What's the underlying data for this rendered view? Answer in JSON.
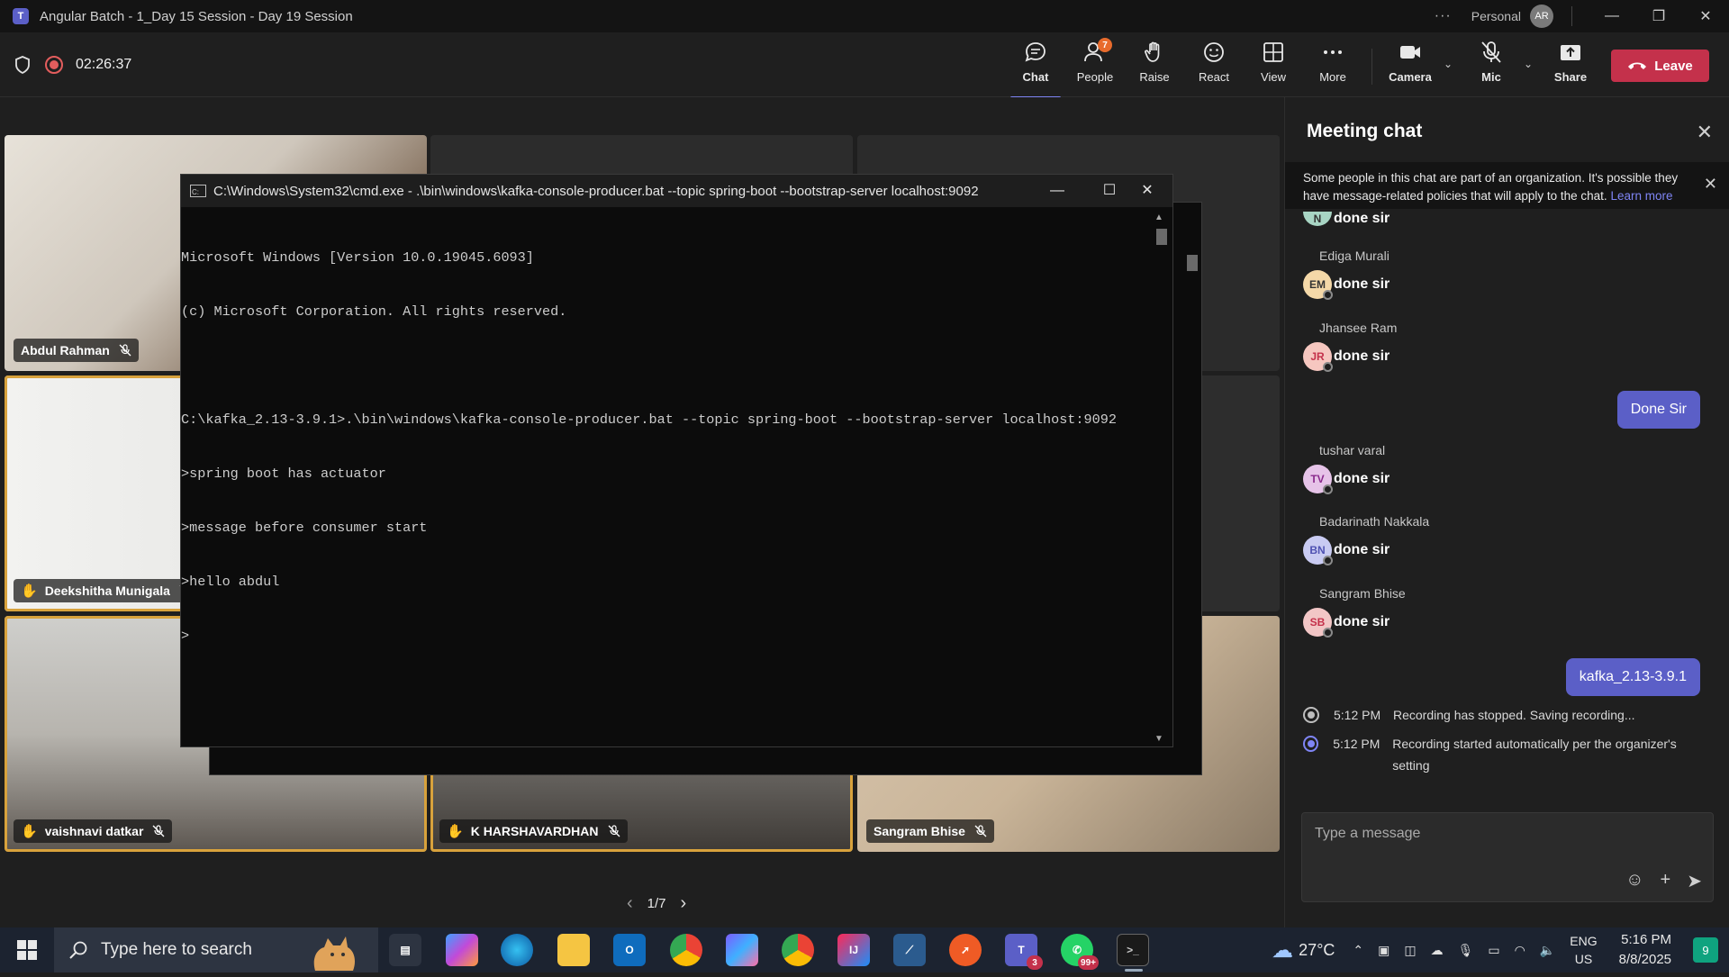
{
  "window": {
    "title": "Angular Batch - 1_Day 15 Session - Day 19 Session",
    "personal": "Personal",
    "account_initials": "AR"
  },
  "toolbar": {
    "timer": "02:26:37",
    "chat": "Chat",
    "people": "People",
    "people_badge": "7",
    "raise": "Raise",
    "react": "React",
    "view": "View",
    "more": "More",
    "camera": "Camera",
    "mic": "Mic",
    "share": "Share",
    "leave": "Leave"
  },
  "participants": [
    {
      "name": "Abdul Rahman",
      "hand": false
    },
    {
      "name": "Deekshitha Munigala",
      "hand": true
    },
    {
      "name": "vaishnavi datkar",
      "hand": true
    },
    {
      "name": "K HARSHAVARDHAN",
      "hand": true
    },
    {
      "name": "Sangram Bhise",
      "hand": false
    }
  ],
  "pager": "1/7",
  "console": {
    "title": "C:\\Windows\\System32\\cmd.exe - .\\bin\\windows\\kafka-console-producer.bat  --topic spring-boot --bootstrap-server localhost:9092",
    "lines": [
      "Microsoft Windows [Version 10.0.19045.6093]",
      "(c) Microsoft Corporation. All rights reserved.",
      "",
      "C:\\kafka_2.13-3.9.1>.\\bin\\windows\\kafka-console-producer.bat --topic spring-boot --bootstrap-server localhost:9092",
      ">spring boot has actuator",
      ">message before consumer start",
      ">hello abdul",
      ">"
    ]
  },
  "chat": {
    "header": "Meeting chat",
    "banner": "Some people in this chat are part of an organization. It's possible they have message-related policies that will apply to the chat.",
    "banner_link": "Learn more",
    "messages": [
      {
        "sender": "",
        "initials": "N",
        "text": "done sir",
        "color": "#a8d5c4"
      },
      {
        "sender": "Ediga Murali",
        "initials": "EM",
        "text": "done sir",
        "color": "#f4d8a8"
      },
      {
        "sender": "Jhansee Ram",
        "initials": "JR",
        "text": "done sir",
        "color": "#f6c7c0"
      },
      {
        "sender": "tushar varal",
        "initials": "TV",
        "text": "done sir",
        "color": "#e6c3e8"
      },
      {
        "sender": "Badarinath Nakkala",
        "initials": "BN",
        "text": "done sir",
        "color": "#c9cbf2"
      },
      {
        "sender": "Sangram Bhise",
        "initials": "SB",
        "text": "done sir",
        "color": "#f2c6c6"
      }
    ],
    "mine_1": "Done Sir",
    "mine_2": "kafka_2.13-3.9.1",
    "sys_1_time": "5:12 PM",
    "sys_1_text": "Recording has stopped. Saving recording...",
    "sys_2_time": "5:12 PM",
    "sys_2_text": "Recording started automatically per the organizer's setting",
    "compose_placeholder": "Type a message"
  },
  "taskbar": {
    "search_placeholder": "Type here to search",
    "weather": "27°C",
    "lang_1": "ENG",
    "lang_2": "US",
    "time": "5:16 PM",
    "date": "8/8/2025",
    "teams_badge": "3",
    "whatsapp_badge": "99+",
    "notif_badge": "9"
  }
}
